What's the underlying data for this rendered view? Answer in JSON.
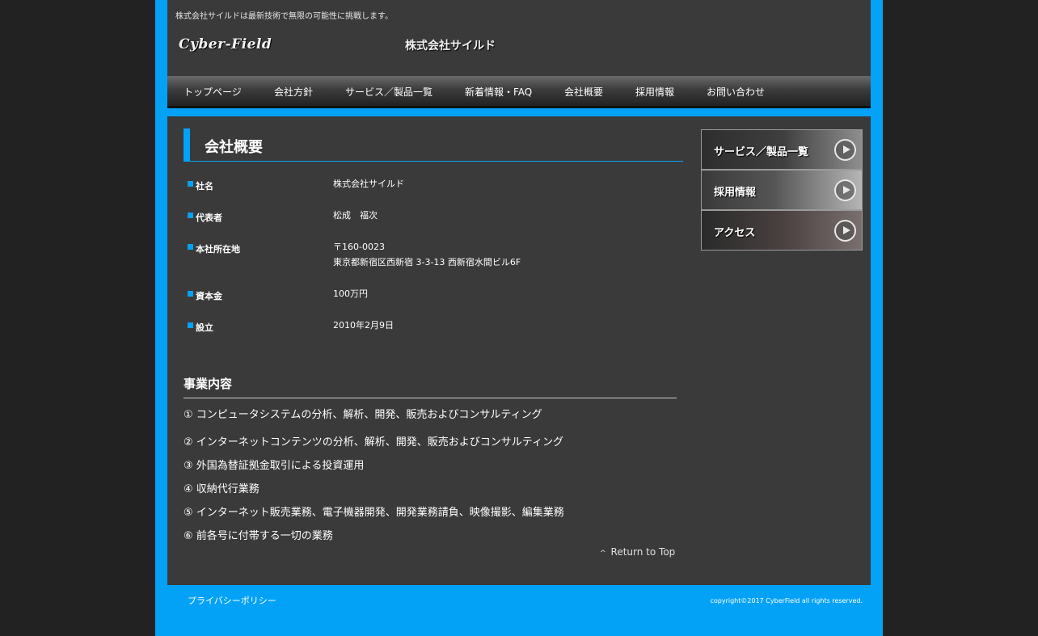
{
  "header": {
    "tagline": "株式会社サイルドは最新技術で無限の可能性に挑戦します。",
    "logo": "Cyber-Field",
    "company_name": "株式会社サイルド"
  },
  "nav": {
    "items": [
      {
        "label": "トップページ"
      },
      {
        "label": "会社方針"
      },
      {
        "label": "サービス／製品一覧"
      },
      {
        "label": "新着情報・FAQ"
      },
      {
        "label": "会社概要"
      },
      {
        "label": "採用情報"
      },
      {
        "label": "お問い合わせ"
      }
    ]
  },
  "main": {
    "title": "会社概要",
    "info": [
      {
        "label": "社名",
        "value": "株式会社サイルド"
      },
      {
        "label": "代表者",
        "value": "松成　福次"
      },
      {
        "label": "本社所在地",
        "value": "〒160-0023",
        "value2": "東京都新宿区西新宿 3-3-13 西新宿水間ビル6F"
      },
      {
        "label": "資本金",
        "value": "100万円"
      },
      {
        "label": "設立",
        "value": "2010年2月9日"
      }
    ],
    "business_title": "事業内容",
    "business_items": [
      "① コンピュータシステムの分析、解析、開発、販売およびコンサルティング",
      "② インターネットコンテンツの分析、解析、開発、販売およびコンサルティング",
      "③ 外国為替証拠金取引による投資運用",
      "④ 収納代行業務",
      "⑤ インターネット販売業務、電子機器開発、開発業務請負、映像撮影、編集業務",
      "⑥ 前各号に付帯する一切の業務"
    ],
    "return_top": "Return to Top"
  },
  "sidebar": {
    "buttons": [
      {
        "label": "サービス／製品一覧"
      },
      {
        "label": "採用情報"
      },
      {
        "label": "アクセス"
      }
    ]
  },
  "footer": {
    "privacy": "プライバシーポリシー",
    "copyright": "copyright©2017 CyberField all rights reserved."
  },
  "colors": {
    "accent": "#03a2f7",
    "panel": "#3a3a3a",
    "background": "#222222"
  }
}
